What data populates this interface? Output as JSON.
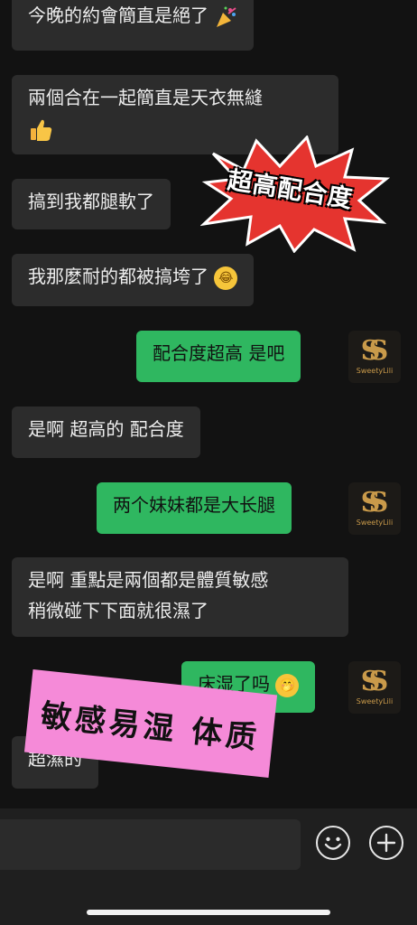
{
  "messages": [
    {
      "side": "in",
      "text": "今晚的約會簡直是絕了",
      "emoji": "party-popper"
    },
    {
      "side": "in",
      "line1": "兩個合在一起簡直是天衣無縫",
      "emoji": "thumbs-up"
    },
    {
      "side": "in",
      "text": "搞到我都腿軟了"
    },
    {
      "side": "in",
      "text": "我那麼耐的都被搞垮了",
      "emoji": "crying-laughing-face"
    },
    {
      "side": "out",
      "text": "配合度超高 是吧"
    },
    {
      "side": "in",
      "text": "是啊 超高的 配合度"
    },
    {
      "side": "out",
      "text": "两个妹妹都是大长腿"
    },
    {
      "side": "in",
      "line1": "是啊 重點是兩個都是體質敏感",
      "line2": "稍微碰下下面就很濕了"
    },
    {
      "side": "out",
      "text": "床湿了吗",
      "emoji": "hand-over-mouth-face"
    },
    {
      "side": "in",
      "text": "超濕的"
    }
  ],
  "avatar": {
    "monogram": "SS",
    "brand": "SweetyLili",
    "color": "#c99a4a"
  },
  "stickers": {
    "burst_text": "超高配合度",
    "pink_text": "敏感易湿 体质"
  },
  "input_bar": {
    "emoji_button": "smiley-icon",
    "add_button": "plus-icon"
  },
  "colors": {
    "background": "#121212",
    "incoming": "#2c2c2c",
    "outgoing": "#2fb760",
    "sticker_red": "#e5342f",
    "sticker_pink": "#f58ad8"
  }
}
